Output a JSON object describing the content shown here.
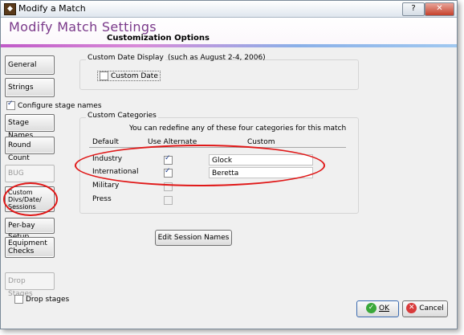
{
  "window": {
    "title": "Modify a Match",
    "help": "?",
    "close": "✕"
  },
  "header": {
    "title": "Modify Match Settings",
    "subtitle": "Customization Options"
  },
  "sidebar": {
    "general": "General",
    "strings": "Strings",
    "configure_stage_names": "Configure stage names",
    "stage_names": "Stage Names",
    "round_count": "Round Count",
    "bug": "BUG",
    "custom_divs": "Custom Divs/Date/ Sessions",
    "per_bay": "Per-bay Setup",
    "equipment": "Equipment Checks",
    "drop_stages": "Drop Stages",
    "drop_stages_chk": "Drop stages"
  },
  "date_display": {
    "label": "Custom Date Display",
    "hint": "(such as August 2-4, 2006)",
    "checkbox": "Custom Date"
  },
  "categories": {
    "label": "Custom Categories",
    "description": "You can redefine any of these four categories for this match",
    "col_default": "Default",
    "col_alternate": "Use Alternate",
    "col_custom": "Custom",
    "rows": [
      {
        "name": "Industry",
        "checked": true,
        "custom": "Glock"
      },
      {
        "name": "International",
        "checked": true,
        "custom": "Beretta"
      },
      {
        "name": "Military",
        "checked": false,
        "custom": ""
      },
      {
        "name": "Press",
        "checked": false,
        "custom": ""
      }
    ]
  },
  "edit_sessions": "Edit Session Names",
  "ok": "OK",
  "cancel": "Cancel"
}
